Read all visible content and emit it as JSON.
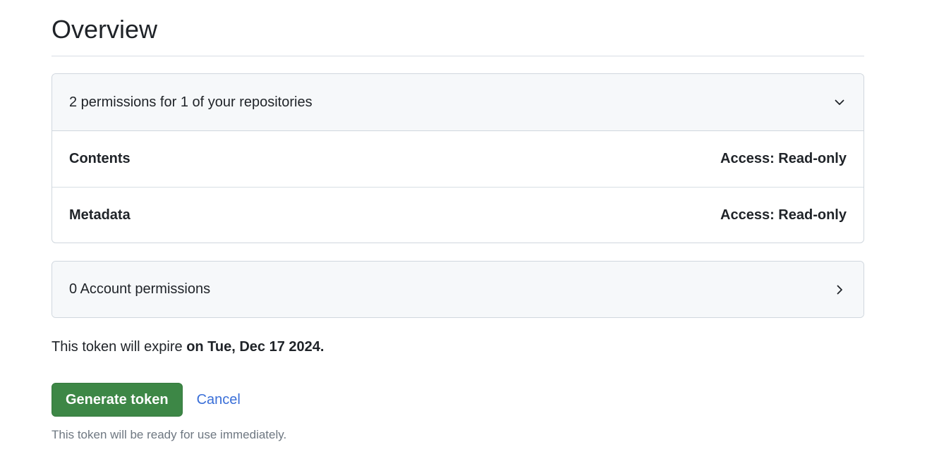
{
  "overview": {
    "title": "Overview"
  },
  "repository_permissions": {
    "summary": "2 permissions for 1 of your repositories",
    "toggle_icon": "chevron-down-icon",
    "rows": [
      {
        "name": "Contents",
        "access": "Access: Read-only"
      },
      {
        "name": "Metadata",
        "access": "Access: Read-only"
      }
    ]
  },
  "account_permissions": {
    "summary": "0 Account permissions",
    "toggle_icon": "chevron-right-icon"
  },
  "expiration": {
    "prefix": "This token will expire",
    "date": "on Tue, Dec 17 2024."
  },
  "actions": {
    "generate_label": "Generate token",
    "cancel_label": "Cancel",
    "hint": "This token will be ready for use immediately."
  },
  "colors": {
    "primary_button": "#3d8746",
    "link": "#3a6fd8",
    "box_header_bg": "#f6f8fa",
    "border": "#d0d7de"
  }
}
